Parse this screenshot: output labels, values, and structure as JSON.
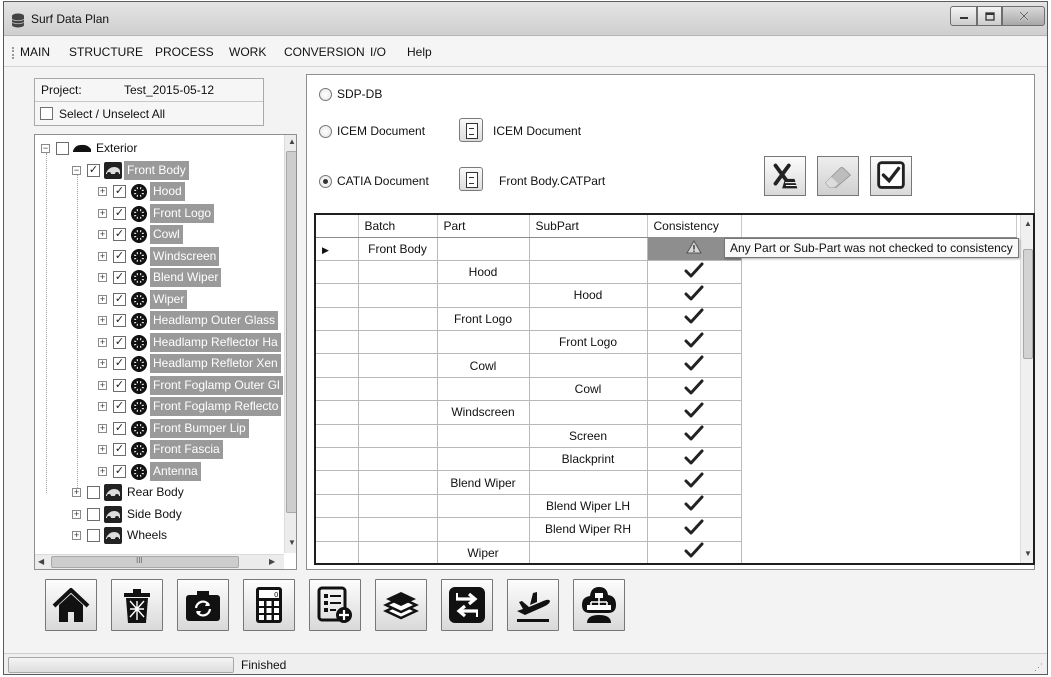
{
  "window": {
    "title": "Surf Data Plan",
    "controls": [
      "minimize-icon",
      "maximize-icon",
      "close-icon"
    ]
  },
  "menu": [
    "MAIN",
    "STRUCTURE",
    "PROCESS",
    "WORK",
    "CONVERSION",
    "I/O",
    "Help"
  ],
  "project": {
    "label": "Project:",
    "value": "Test_2015-05-12",
    "select_all_label": "Select / Unselect All"
  },
  "tree": {
    "nodes": [
      {
        "label": "Exterior",
        "level": 0,
        "checked": false,
        "selected": false,
        "icon": "car-icon",
        "expander": "-"
      },
      {
        "label": "Front Body",
        "level": 1,
        "checked": true,
        "selected": true,
        "icon": "car-part-icon",
        "expander": "-"
      },
      {
        "label": "Hood",
        "level": 2,
        "checked": true,
        "selected": true,
        "icon": "gear-icon",
        "expander": "+"
      },
      {
        "label": "Front Logo",
        "level": 2,
        "checked": true,
        "selected": true,
        "icon": "gear-icon",
        "expander": "+"
      },
      {
        "label": "Cowl",
        "level": 2,
        "checked": true,
        "selected": true,
        "icon": "gear-icon",
        "expander": "+"
      },
      {
        "label": "Windscreen",
        "level": 2,
        "checked": true,
        "selected": true,
        "icon": "gear-icon",
        "expander": "+"
      },
      {
        "label": "Blend Wiper",
        "level": 2,
        "checked": true,
        "selected": true,
        "icon": "gear-icon",
        "expander": "+"
      },
      {
        "label": "Wiper",
        "level": 2,
        "checked": true,
        "selected": true,
        "icon": "gear-icon",
        "expander": "+"
      },
      {
        "label": "Headlamp Outer Glass",
        "level": 2,
        "checked": true,
        "selected": true,
        "icon": "gear-icon",
        "expander": "+"
      },
      {
        "label": "Headlamp Reflector Ha",
        "level": 2,
        "checked": true,
        "selected": true,
        "icon": "gear-icon",
        "expander": "+"
      },
      {
        "label": "Headlamp Refletor Xen",
        "level": 2,
        "checked": true,
        "selected": true,
        "icon": "gear-icon",
        "expander": "+"
      },
      {
        "label": "Front Foglamp Outer Gl",
        "level": 2,
        "checked": true,
        "selected": true,
        "icon": "gear-icon",
        "expander": "+"
      },
      {
        "label": "Front Foglamp Reflecto",
        "level": 2,
        "checked": true,
        "selected": true,
        "icon": "gear-icon",
        "expander": "+"
      },
      {
        "label": "Front Bumper Lip",
        "level": 2,
        "checked": true,
        "selected": true,
        "icon": "gear-icon",
        "expander": "+"
      },
      {
        "label": "Front Fascia",
        "level": 2,
        "checked": true,
        "selected": true,
        "icon": "gear-icon",
        "expander": "+"
      },
      {
        "label": "Antenna",
        "level": 2,
        "checked": true,
        "selected": true,
        "icon": "gear-icon",
        "expander": "+"
      },
      {
        "label": "Rear Body",
        "level": 1,
        "checked": false,
        "selected": false,
        "icon": "car-part-icon",
        "expander": "+"
      },
      {
        "label": "Side Body",
        "level": 1,
        "checked": false,
        "selected": false,
        "icon": "car-part-icon",
        "expander": "+"
      },
      {
        "label": "Wheels",
        "level": 1,
        "checked": false,
        "selected": false,
        "icon": "car-part-icon",
        "expander": "+"
      }
    ],
    "hscroll_glyph": "III"
  },
  "sources": {
    "sdp_db": {
      "label": "SDP-DB",
      "selected": false
    },
    "icem": {
      "label": "ICEM Document",
      "selected": false,
      "file": "ICEM Document"
    },
    "catia": {
      "label": "CATIA Document",
      "selected": true,
      "file": "Front Body.CATPart"
    }
  },
  "actions": [
    "clear-icon",
    "eraser-icon",
    "checkbox-checked-icon"
  ],
  "grid": {
    "columns": [
      "Batch",
      "Part",
      "SubPart",
      "Consistency"
    ],
    "rows": [
      {
        "batch": "Front Body",
        "part": "",
        "subpart": "",
        "consistency": "warning",
        "current": true
      },
      {
        "batch": "",
        "part": "Hood",
        "subpart": "",
        "consistency": "check",
        "current": false
      },
      {
        "batch": "",
        "part": "",
        "subpart": "Hood",
        "consistency": "check",
        "current": false
      },
      {
        "batch": "",
        "part": "Front Logo",
        "subpart": "",
        "consistency": "check",
        "current": false
      },
      {
        "batch": "",
        "part": "",
        "subpart": "Front Logo",
        "consistency": "check",
        "current": false
      },
      {
        "batch": "",
        "part": "Cowl",
        "subpart": "",
        "consistency": "check",
        "current": false
      },
      {
        "batch": "",
        "part": "",
        "subpart": "Cowl",
        "consistency": "check",
        "current": false
      },
      {
        "batch": "",
        "part": "Windscreen",
        "subpart": "",
        "consistency": "check",
        "current": false
      },
      {
        "batch": "",
        "part": "",
        "subpart": "Screen",
        "consistency": "check",
        "current": false
      },
      {
        "batch": "",
        "part": "",
        "subpart": "Blackprint",
        "consistency": "check",
        "current": false
      },
      {
        "batch": "",
        "part": "Blend Wiper",
        "subpart": "",
        "consistency": "check",
        "current": false
      },
      {
        "batch": "",
        "part": "",
        "subpart": "Blend Wiper LH",
        "consistency": "check",
        "current": false
      },
      {
        "batch": "",
        "part": "",
        "subpart": "Blend Wiper RH",
        "consistency": "check",
        "current": false
      },
      {
        "batch": "",
        "part": "Wiper",
        "subpart": "",
        "consistency": "check",
        "current": false
      }
    ],
    "tooltip": "Any Part or Sub-Part was not checked to consistency"
  },
  "toolbar": [
    "home-icon",
    "trash-icon",
    "camera-rotate-icon",
    "calculator-icon",
    "list-add-icon",
    "layers-icon",
    "transfer-icon",
    "plane-takeoff-icon",
    "cloud-network-icon"
  ],
  "status": {
    "text": "Finished",
    "progress": 0
  }
}
